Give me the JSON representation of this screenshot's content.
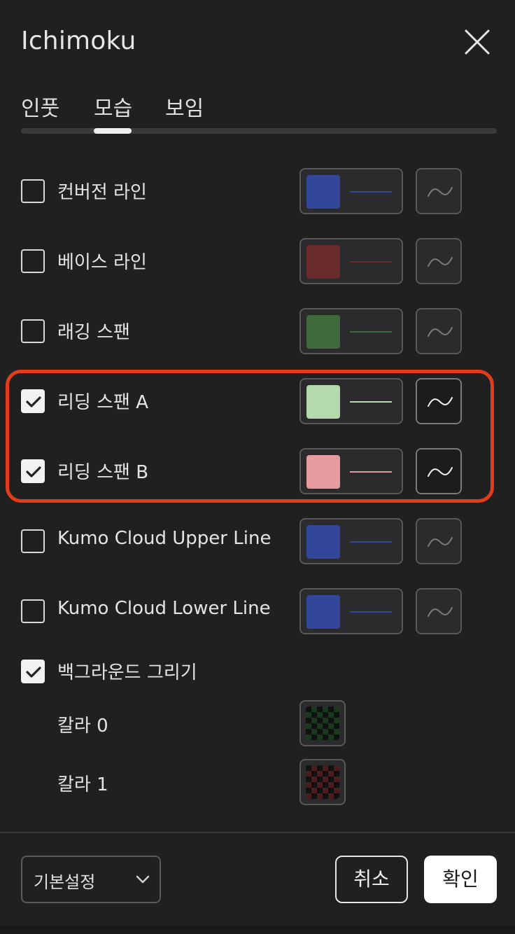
{
  "dialog": {
    "title": "Ichimoku"
  },
  "tabs": [
    {
      "label": "인풋"
    },
    {
      "label": "모습",
      "active": true
    },
    {
      "label": "보임"
    }
  ],
  "rows": [
    {
      "label": "컨버전 라인",
      "checked": false,
      "color": "#33479a"
    },
    {
      "label": "베이스 라인",
      "checked": false,
      "color": "#6b2a2b"
    },
    {
      "label": "래깅 스팬",
      "checked": false,
      "color": "#3f6a3c"
    },
    {
      "label": "리딩 스팬 A",
      "checked": true,
      "color": "#b3d9ac"
    },
    {
      "label": "리딩 스팬 B",
      "checked": true,
      "color": "#e59c9e"
    },
    {
      "label": "Kumo Cloud Upper Line",
      "checked": false,
      "color": "#33479a"
    },
    {
      "label": "Kumo Cloud Lower Line",
      "checked": false,
      "color": "#33479a"
    }
  ],
  "background": {
    "label": "백그라운드 그리기",
    "checked": true,
    "colors": [
      {
        "label": "칼라 0",
        "color": "#1a3a1f"
      },
      {
        "label": "칼라 1",
        "color": "#4a1c20"
      }
    ]
  },
  "footer": {
    "preset_value": "기본설정",
    "cancel_label": "취소",
    "ok_label": "확인"
  }
}
